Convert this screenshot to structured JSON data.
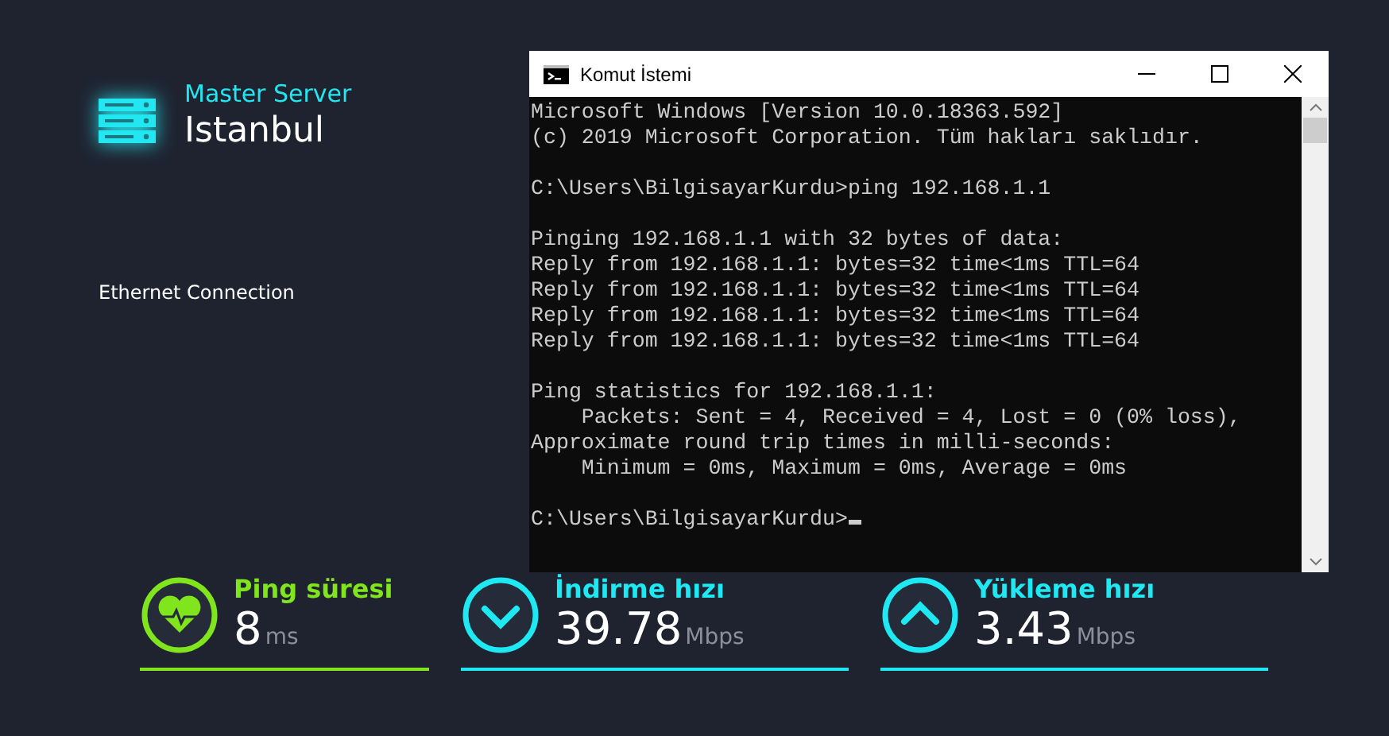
{
  "server": {
    "label": "Master Server",
    "city": "Istanbul"
  },
  "connection": "Ethernet Connection",
  "terminal": {
    "title": "Komut İstemi",
    "cursor": true,
    "blocks": [
      [
        "Microsoft Windows [Version 10.0.18363.592]",
        "(c) 2019 Microsoft Corporation. Tüm hakları saklıdır."
      ],
      [
        "C:\\Users\\BilgisayarKurdu>ping 192.168.1.1"
      ],
      [
        "Pinging 192.168.1.1 with 32 bytes of data:",
        "Reply from 192.168.1.1: bytes=32 time<1ms TTL=64",
        "Reply from 192.168.1.1: bytes=32 time<1ms TTL=64",
        "Reply from 192.168.1.1: bytes=32 time<1ms TTL=64",
        "Reply from 192.168.1.1: bytes=32 time<1ms TTL=64"
      ],
      [
        "Ping statistics for 192.168.1.1:",
        "    Packets: Sent = 4, Received = 4, Lost = 0 (0% loss),",
        "Approximate round trip times in milli-seconds:",
        "    Minimum = 0ms, Maximum = 0ms, Average = 0ms"
      ],
      [
        "C:\\Users\\BilgisayarKurdu>"
      ]
    ]
  },
  "stats": [
    {
      "kind": "ping",
      "color": "#80e51c",
      "label": "Ping süresi",
      "value": "8",
      "unit": "ms"
    },
    {
      "kind": "download",
      "color": "#1ee8f2",
      "label": "İndirme hızı",
      "value": "39.78",
      "unit": "Mbps"
    },
    {
      "kind": "upload",
      "color": "#1ee8f2",
      "label": "Yükleme hızı",
      "value": "3.43",
      "unit": "Mbps"
    }
  ]
}
